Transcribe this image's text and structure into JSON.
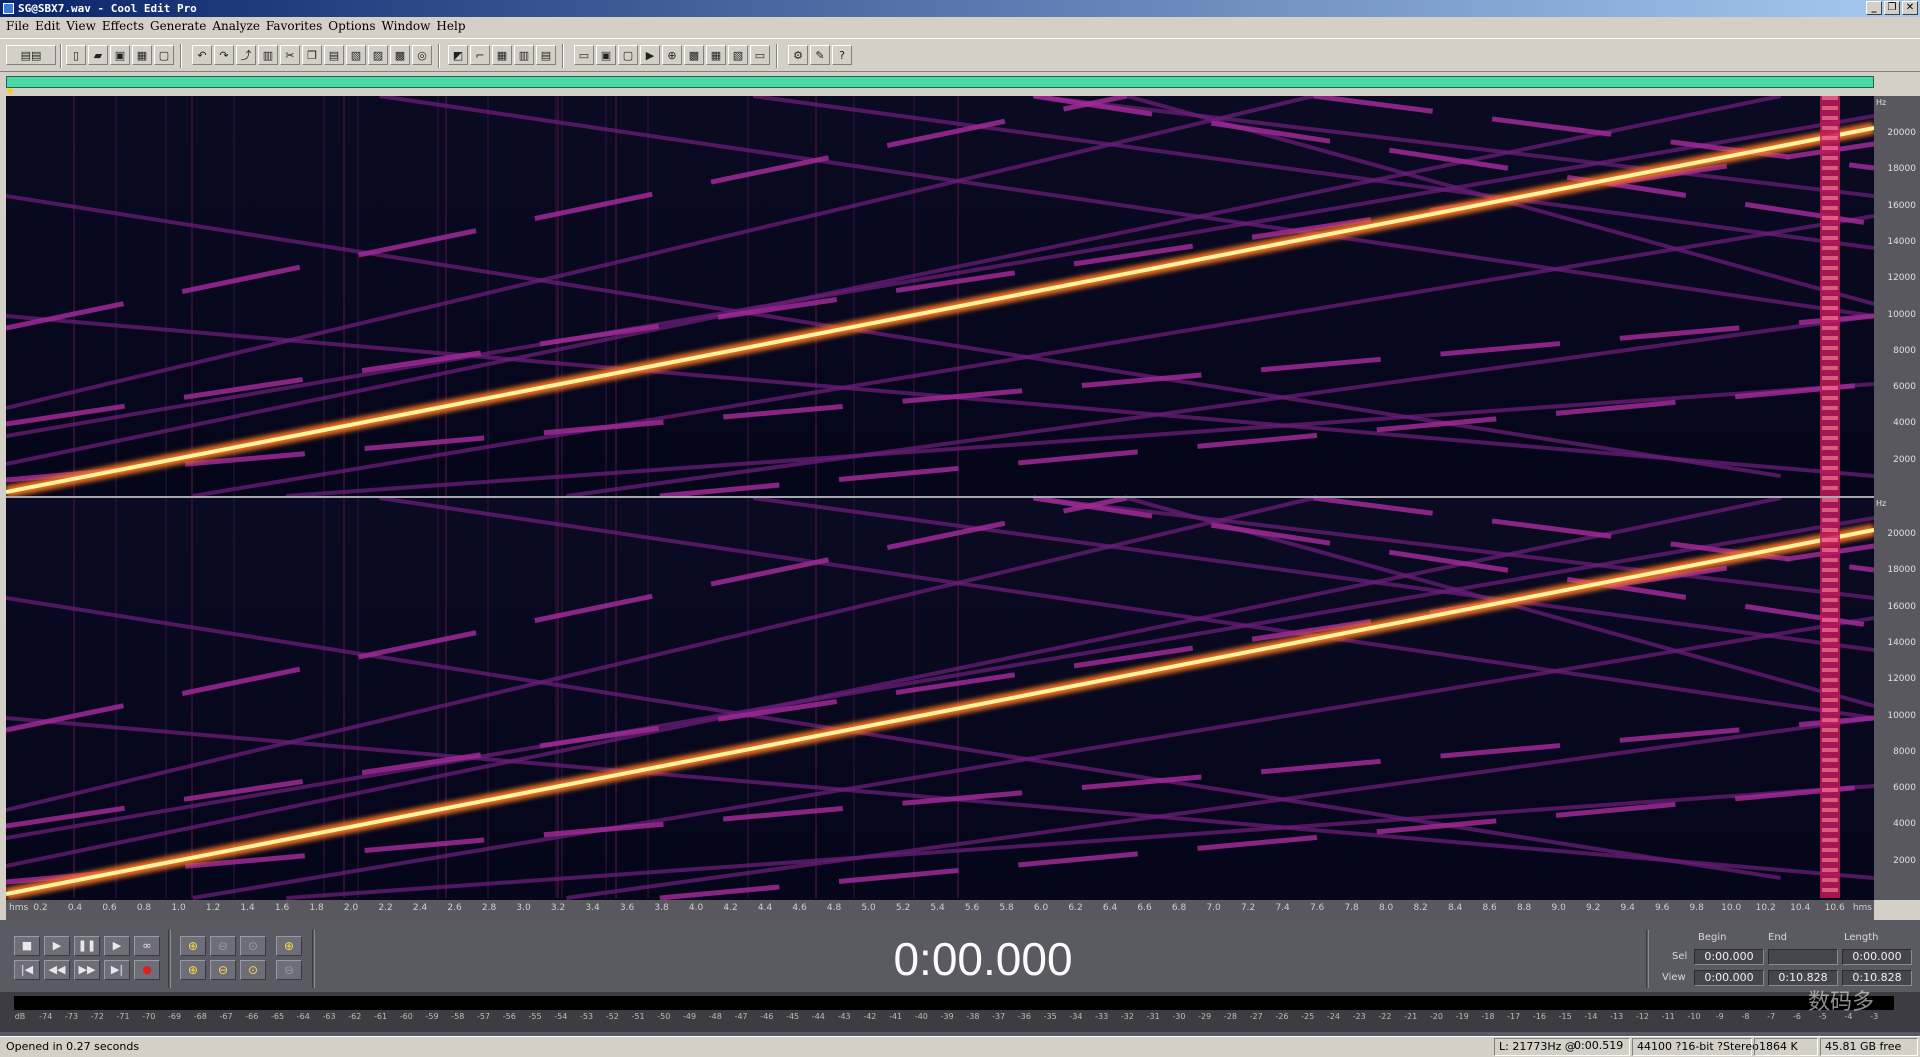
{
  "window": {
    "title": "SG@SBX7.wav - Cool Edit Pro",
    "minimize_icon": "minimize-icon",
    "maximize_icon": "restore-icon",
    "close_icon": "close-icon",
    "minimize_glyph": "_",
    "restore_glyph": "❐",
    "close_glyph": "✕"
  },
  "menu": [
    "File",
    "Edit",
    "View",
    "Effects",
    "Generate",
    "Analyze",
    "Favorites",
    "Options",
    "Window",
    "Help"
  ],
  "toolbar": {
    "icons": [
      "multitrack-toggle-icon",
      "new-icon",
      "open-icon",
      "save-icon",
      "save-selection-icon",
      "close-file-icon",
      "undo-icon",
      "redo-icon",
      "repeat-icon",
      "cut-copy-icon",
      "cut-icon",
      "copy-icon",
      "paste-icon",
      "mix-paste-icon",
      "trim-icon",
      "delete-icon",
      "spectral-view-icon",
      "waveform-view-icon",
      "grid-icon",
      "snap-icon",
      "marker-icon",
      "loop-icon",
      "play-icon",
      "zoom-icon",
      "time-format-icon",
      "cd-icon",
      "meter-icon",
      "settings-icon",
      "script-icon",
      "help-icon"
    ]
  },
  "hz_axis": {
    "unit": "Hz",
    "labels": [
      "20000",
      "18000",
      "16000",
      "14000",
      "12000",
      "10000",
      "8000",
      "6000",
      "4000",
      "2000"
    ]
  },
  "time_ruler": {
    "first_label": "hms",
    "labels": [
      "0.2",
      "0.4",
      "0.6",
      "0.8",
      "1.0",
      "1.2",
      "1.4",
      "1.6",
      "1.8",
      "2.0",
      "2.2",
      "2.4",
      "2.6",
      "2.8",
      "3.0",
      "3.2",
      "3.4",
      "3.6",
      "3.8",
      "4.0",
      "4.2",
      "4.4",
      "4.6",
      "4.8",
      "5.0",
      "5.2",
      "5.4",
      "5.6",
      "5.8",
      "6.0",
      "6.2",
      "6.4",
      "6.6",
      "6.8",
      "7.0",
      "7.2",
      "7.4",
      "7.6",
      "7.8",
      "8.0",
      "8.2",
      "8.4",
      "8.6",
      "8.8",
      "9.0",
      "9.2",
      "9.4",
      "9.6",
      "9.8",
      "10.0",
      "10.2",
      "10.4",
      "10.6"
    ],
    "last_label": "hms"
  },
  "transport": {
    "stop": "■",
    "play": "▶",
    "pause": "❚❚",
    "play_to_end": "▶",
    "loop": "∞",
    "goto_start": "|◀",
    "rewind": "◀◀",
    "fast_forward": "▶▶",
    "goto_end": "▶|",
    "record": "●"
  },
  "zoom": {
    "zoom_in_h": "⊕",
    "zoom_out_h": "⊖",
    "zoom_full": "⊙",
    "zoom_in_v": "⊕",
    "zoom_left": "⊕",
    "zoom_right": "⊖",
    "zoom_sel": "⊙",
    "zoom_out_v": "⊖"
  },
  "time_display": "0:00.000",
  "selection": {
    "headers": {
      "begin": "Begin",
      "end": "End",
      "length": "Length"
    },
    "sel_label": "Sel",
    "view_label": "View",
    "sel_begin": "0:00.000",
    "sel_end": "",
    "sel_length": "0:00.000",
    "view_begin": "0:00.000",
    "view_end": "0:10.828",
    "view_length": "0:10.828"
  },
  "level_meter": {
    "labels": [
      "dB",
      "-74",
      "-73",
      "-72",
      "-71",
      "-70",
      "-69",
      "-68",
      "-67",
      "-66",
      "-65",
      "-64",
      "-63",
      "-62",
      "-61",
      "-60",
      "-59",
      "-58",
      "-57",
      "-56",
      "-55",
      "-54",
      "-53",
      "-52",
      "-51",
      "-50",
      "-49",
      "-48",
      "-47",
      "-46",
      "-45",
      "-44",
      "-43",
      "-42",
      "-41",
      "-40",
      "-39",
      "-38",
      "-37",
      "-36",
      "-35",
      "-34",
      "-33",
      "-32",
      "-31",
      "-30",
      "-29",
      "-28",
      "-27",
      "-26",
      "-25",
      "-24",
      "-23",
      "-22",
      "-21",
      "-20",
      "-19",
      "-18",
      "-17",
      "-16",
      "-15",
      "-14",
      "-13",
      "-12",
      "-11",
      "-10",
      "-9",
      "-8",
      "-7",
      "-6",
      "-5",
      "-4",
      "-3"
    ]
  },
  "status": {
    "message": "Opened in 0.27 seconds",
    "cursor": "L: 21773Hz @",
    "cursor_time": "0:00.519",
    "format": "44100 ?16-bit ?Stereo",
    "size": "1864 K",
    "free": "45.81 GB free"
  },
  "watermark": "数码多"
}
